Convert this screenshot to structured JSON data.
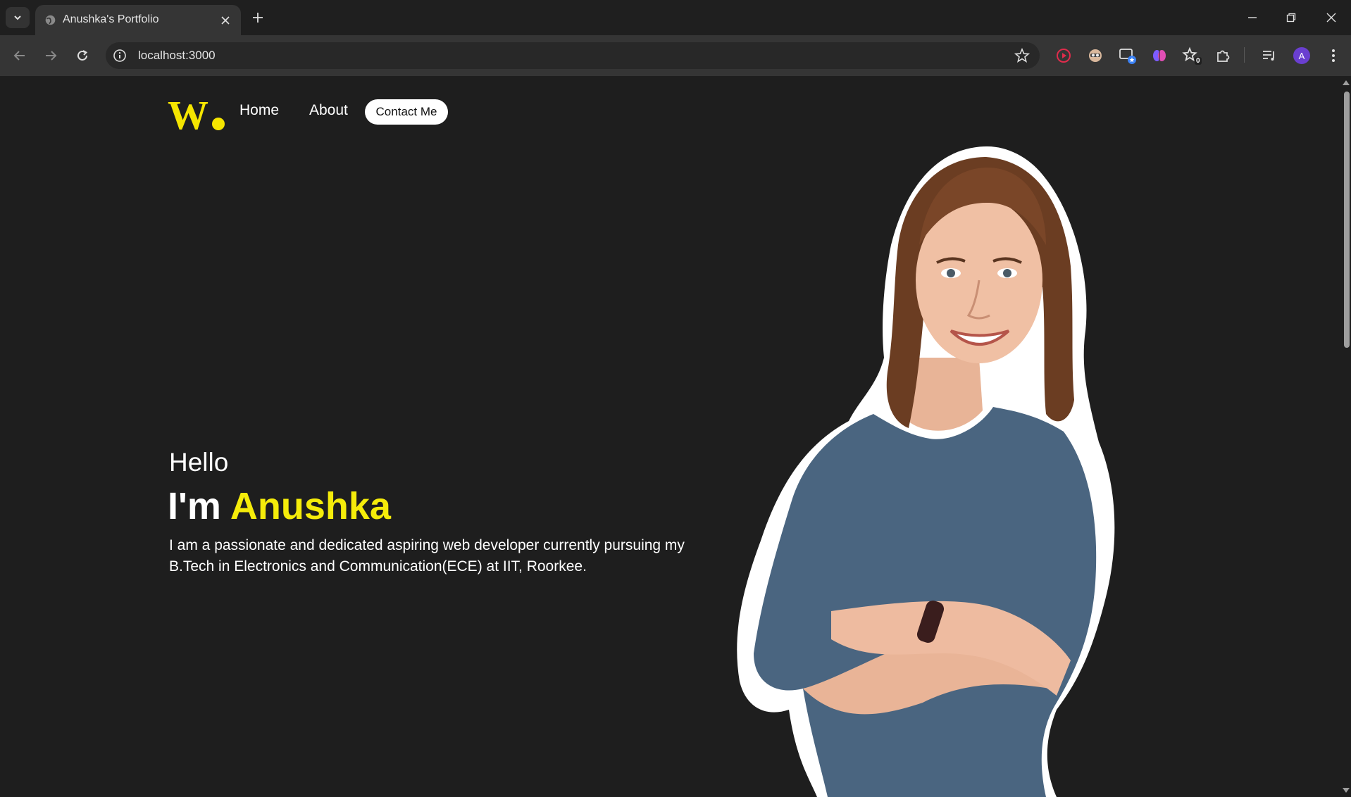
{
  "browser": {
    "tab_title": "Anushka's Portfolio",
    "url": "localhost:3000",
    "extension_badge": "0",
    "profile_initial": "A"
  },
  "nav": {
    "logo_letter": "W",
    "links": [
      "Home",
      "About"
    ],
    "contact_label": "Contact Me"
  },
  "hero": {
    "greeting": "Hello",
    "headline_prefix": "I'm ",
    "name": "Anushka",
    "intro": "I am a passionate and dedicated aspiring web developer currently pursuing my B.Tech in Electronics and Communication(ECE) at IIT, Roorkee."
  },
  "colors": {
    "accent": "#f5ec0a",
    "background": "#1e1e1e",
    "shirt": "#4a6580"
  },
  "icons": [
    "chevron-down-icon",
    "globe-icon",
    "close-icon",
    "plus-icon",
    "minimize-icon",
    "restore-icon",
    "back-icon",
    "forward-icon",
    "reload-icon",
    "info-icon",
    "star-icon",
    "record-icon",
    "mask-icon",
    "cast-icon",
    "brain-icon",
    "favorites-icon",
    "puzzle-icon",
    "media-icon",
    "menu-icon"
  ]
}
